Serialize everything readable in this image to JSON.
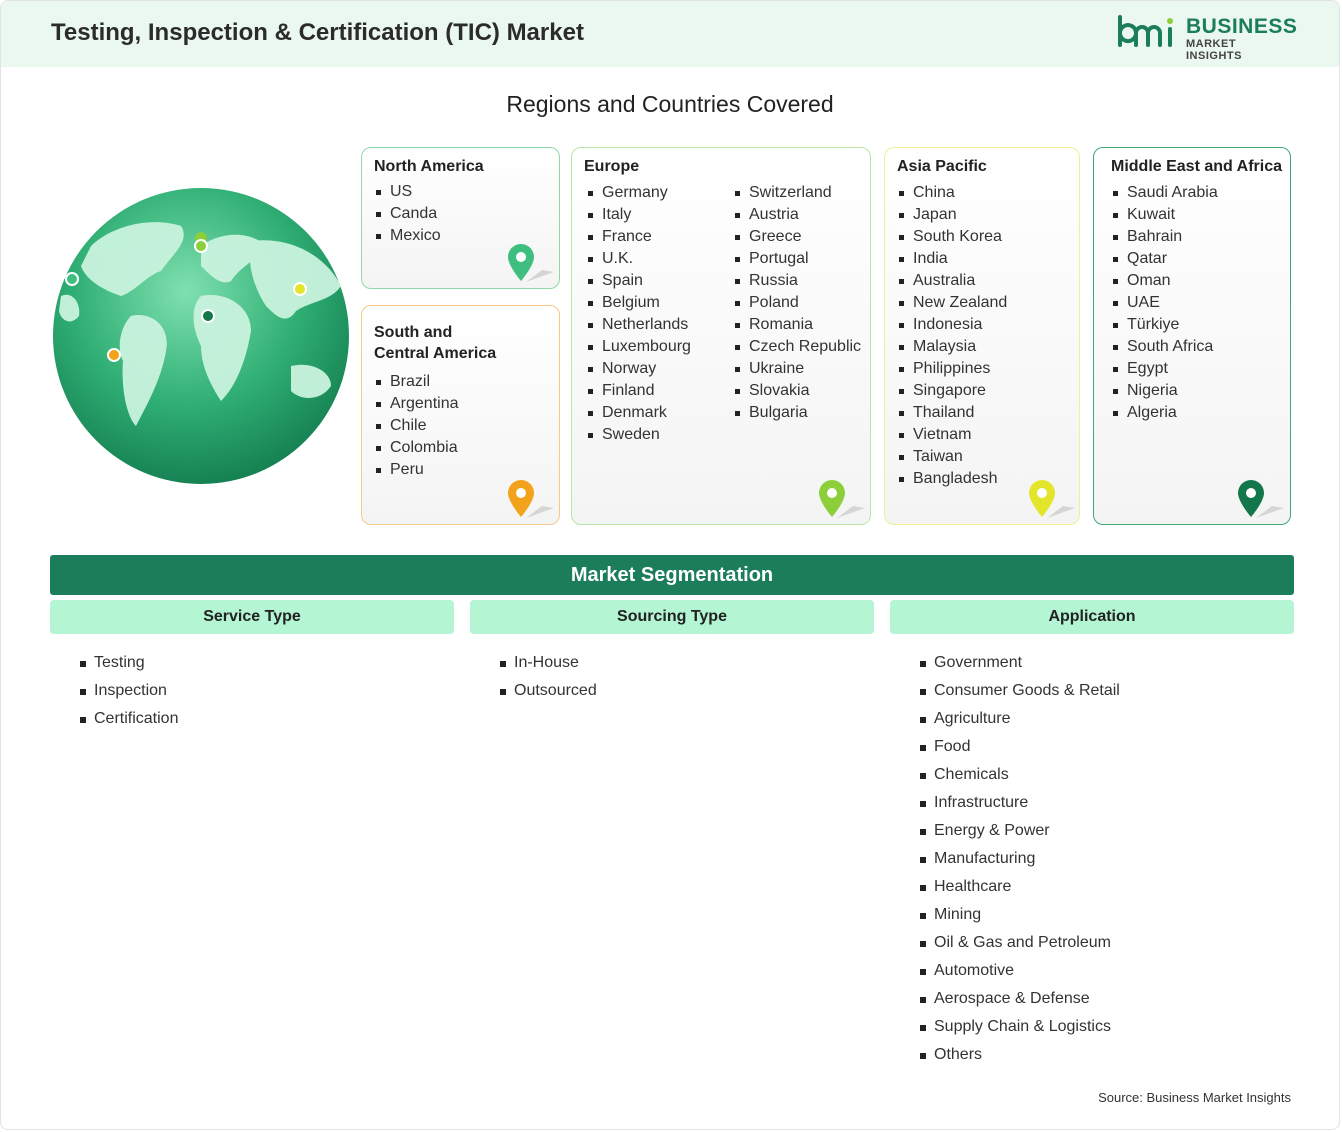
{
  "header": {
    "title": "Testing, Inspection & Certification (TIC) Market",
    "logo_line1": "BUSINESS",
    "logo_line2": "MARKET INSIGHTS",
    "logo_mark_text": "bmi"
  },
  "regions_title": "Regions and Countries Covered",
  "regions": {
    "north_america": {
      "title": "North America",
      "countries": [
        "US",
        "Canda",
        "Mexico"
      ],
      "color": "#8fd9a8"
    },
    "south_central_america": {
      "title_line1": "South and",
      "title_line2": "Central America",
      "countries": [
        "Brazil",
        "Argentina",
        "Chile",
        "Colombia",
        "Peru"
      ],
      "color": "#f7c98a"
    },
    "europe": {
      "title": "Europe",
      "countries_col1": [
        "Germany",
        "Italy",
        "France",
        "U.K.",
        "Spain",
        "Belgium",
        "Netherlands",
        "Luxembourg",
        "Norway",
        "Finland",
        "Denmark",
        "Sweden"
      ],
      "countries_col2": [
        "Switzerland",
        "Austria",
        "Greece",
        "Portugal",
        "Russia",
        "Poland",
        "Romania",
        "Czech Republic",
        "Ukraine",
        "Slovakia",
        "Bulgaria"
      ],
      "color": "#b9e7a6"
    },
    "asia_pacific": {
      "title": "Asia Pacific",
      "countries": [
        "China",
        "Japan",
        "South Korea",
        "India",
        "Australia",
        "New Zealand",
        "Indonesia",
        "Malaysia",
        "Philippines",
        "Singapore",
        "Thailand",
        "Vietnam",
        "Taiwan",
        "Bangladesh"
      ],
      "color": "#f0ef9a"
    },
    "middle_east_africa": {
      "title": "Middle East and Africa",
      "countries": [
        "Saudi Arabia",
        "Kuwait",
        "Bahrain",
        "Qatar",
        "Oman",
        "UAE",
        "Türkiye",
        "South Africa",
        "Egypt",
        "Nigeria",
        "Algeria"
      ],
      "color": "#3fa877"
    }
  },
  "pin_colors": {
    "north_america": "#3fbf7f",
    "south_central_america": "#f2a21b",
    "europe": "#8ccf3a",
    "asia_pacific": "#e3e52a",
    "middle_east_africa": "#13774b"
  },
  "segmentation": {
    "title": "Market Segmentation",
    "columns": [
      {
        "heading": "Service Type",
        "items": [
          "Testing",
          "Inspection",
          "Certification"
        ]
      },
      {
        "heading": "Sourcing Type",
        "items": [
          "In-House",
          "Outsourced"
        ]
      },
      {
        "heading": "Application",
        "items": [
          "Government",
          "Consumer Goods & Retail",
          "Agriculture",
          "Food",
          "Chemicals",
          "Infrastructure",
          "Energy & Power",
          "Manufacturing",
          "Healthcare",
          "Mining",
          "Oil & Gas and Petroleum",
          "Automotive",
          "Aerospace & Defense",
          "Supply Chain & Logistics",
          "Others"
        ]
      }
    ]
  },
  "source": "Source: Business Market Insights"
}
